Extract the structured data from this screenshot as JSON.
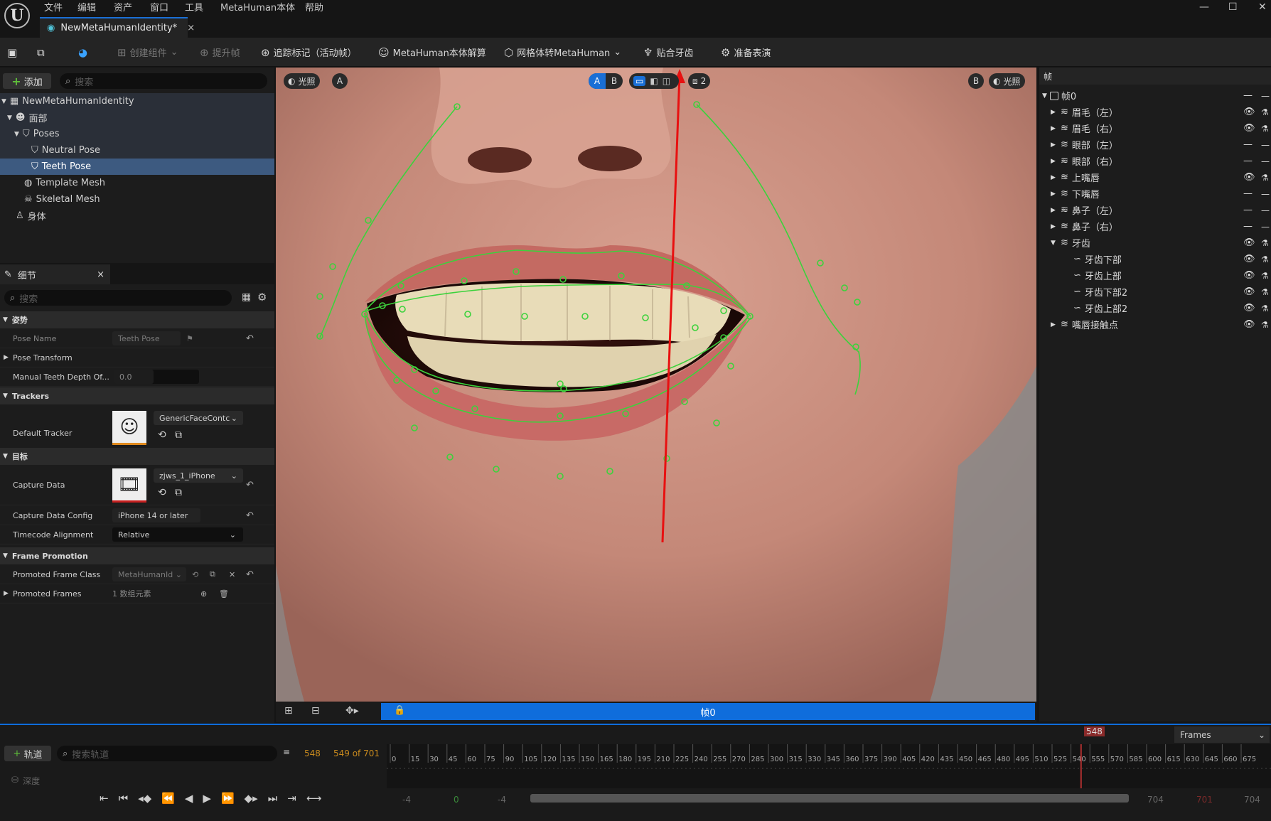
{
  "menu": [
    "文件",
    "编辑",
    "资产",
    "窗口",
    "工具",
    "MetaHuman本体",
    "帮助"
  ],
  "doc_tab": {
    "title": "NewMetaHumanIdentity*"
  },
  "toolbar": {
    "create_component": "创建组件",
    "promote_frame": "提升帧",
    "track_markers": "追踪标记（活动帧）",
    "identity_solve": "MetaHuman本体解算",
    "mesh_to_metahuman": "网格体转MetaHuman",
    "fit_teeth": "贴合牙齿",
    "prepare_performance": "准备表演"
  },
  "outliner": {
    "add_label": "添加",
    "search_placeholder": "搜索",
    "items": [
      {
        "label": "NewMetaHumanIdentity"
      },
      {
        "label": "面部"
      },
      {
        "label": "Poses"
      },
      {
        "label": "Neutral Pose"
      },
      {
        "label": "Teeth Pose"
      },
      {
        "label": "Template Mesh"
      },
      {
        "label": "Skeletal Mesh"
      },
      {
        "label": "身体"
      }
    ]
  },
  "details": {
    "tab_label": "细节",
    "search_placeholder": "搜索",
    "sec_pose": "姿势",
    "pose_name_label": "Pose Name",
    "pose_name_value": "Teeth Pose",
    "pose_transform_label": "Pose Transform",
    "manual_teeth_label": "Manual Teeth Depth Of...",
    "manual_teeth_value": "0.0",
    "sec_trackers": "Trackers",
    "default_tracker_label": "Default Tracker",
    "default_tracker_value": "GenericFaceContc",
    "sec_target": "目标",
    "capture_data_label": "Capture Data",
    "capture_data_value": "zjws_1_iPhone",
    "capture_config_label": "Capture Data Config",
    "capture_config_value": "iPhone 14 or later",
    "timecode_label": "Timecode Alignment",
    "timecode_value": "Relative",
    "sec_frame_promotion": "Frame Promotion",
    "promoted_class_label": "Promoted Frame Class",
    "promoted_class_value": "MetaHumanId",
    "promoted_frames_label": "Promoted Frames",
    "promoted_frames_value": "1 数组元素"
  },
  "viewport": {
    "lit_left": "光照",
    "a_left": "A",
    "a_toggle": "A",
    "b_toggle": "B",
    "camera_count": "2",
    "b_right": "B",
    "lit_right": "光照",
    "frame_label": "帧0"
  },
  "right_panel": {
    "header": "帧",
    "root": "帧0",
    "items": [
      {
        "label": "眉毛（左）",
        "visible": true
      },
      {
        "label": "眉毛（右）",
        "visible": true
      },
      {
        "label": "眼部（左）",
        "visible": false
      },
      {
        "label": "眼部（右）",
        "visible": false
      },
      {
        "label": "上嘴唇",
        "visible": true
      },
      {
        "label": "下嘴唇",
        "visible": false
      },
      {
        "label": "鼻子（左）",
        "visible": false
      },
      {
        "label": "鼻子（右）",
        "visible": false
      },
      {
        "label": "牙齿",
        "visible": true
      },
      {
        "label": "牙齿下部",
        "visible": true
      },
      {
        "label": "牙齿上部",
        "visible": true
      },
      {
        "label": "牙齿下部2",
        "visible": true
      },
      {
        "label": "牙齿上部2",
        "visible": true
      },
      {
        "label": "嘴唇接触点",
        "visible": true
      }
    ]
  },
  "timeline": {
    "track_label": "轨道",
    "search_placeholder": "搜索轨道",
    "current_frame": "548",
    "frame_of": "549 of 701",
    "depth_label": "深度",
    "frames_dropdown": "Frames",
    "playhead_label": "548",
    "ticks": [
      "0",
      "15",
      "30",
      "45",
      "60",
      "75",
      "90",
      "105",
      "120",
      "135",
      "150",
      "165",
      "180",
      "195",
      "210",
      "225",
      "240",
      "255",
      "270",
      "285",
      "300",
      "315",
      "330",
      "345",
      "360",
      "375",
      "390",
      "405",
      "420",
      "435",
      "450",
      "465",
      "480",
      "495",
      "510",
      "525",
      "540",
      "555",
      "570",
      "585",
      "600",
      "615",
      "630",
      "645",
      "660",
      "675"
    ],
    "range_start_a": "-4",
    "range_zero": "0",
    "range_start_b": "-4",
    "range_end_a": "704",
    "range_end_b": "701",
    "range_end_c": "704"
  }
}
